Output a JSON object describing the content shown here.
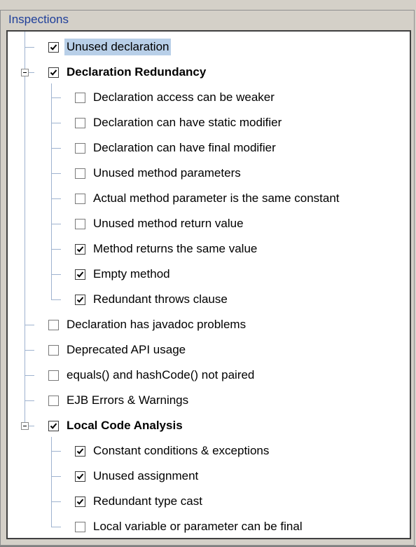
{
  "panel": {
    "title": "Inspections"
  },
  "tree": {
    "items": [
      {
        "label": "Unused declaration",
        "checked": true,
        "level": 0,
        "selected": true,
        "bold": false,
        "expanded": false,
        "last": false
      },
      {
        "label": "Declaration Redundancy",
        "checked": true,
        "level": 0,
        "selected": false,
        "bold": true,
        "expanded": true,
        "last": false
      },
      {
        "label": "Declaration access can be weaker",
        "checked": false,
        "level": 1,
        "selected": false,
        "bold": false,
        "expanded": false,
        "last": false
      },
      {
        "label": "Declaration can have static modifier",
        "checked": false,
        "level": 1,
        "selected": false,
        "bold": false,
        "expanded": false,
        "last": false
      },
      {
        "label": "Declaration can have final modifier",
        "checked": false,
        "level": 1,
        "selected": false,
        "bold": false,
        "expanded": false,
        "last": false
      },
      {
        "label": "Unused method parameters",
        "checked": false,
        "level": 1,
        "selected": false,
        "bold": false,
        "expanded": false,
        "last": false
      },
      {
        "label": "Actual method parameter is the same constant",
        "checked": false,
        "level": 1,
        "selected": false,
        "bold": false,
        "expanded": false,
        "last": false
      },
      {
        "label": "Unused method return value",
        "checked": false,
        "level": 1,
        "selected": false,
        "bold": false,
        "expanded": false,
        "last": false
      },
      {
        "label": "Method returns the same value",
        "checked": true,
        "level": 1,
        "selected": false,
        "bold": false,
        "expanded": false,
        "last": false
      },
      {
        "label": "Empty method",
        "checked": true,
        "level": 1,
        "selected": false,
        "bold": false,
        "expanded": false,
        "last": false
      },
      {
        "label": "Redundant throws clause",
        "checked": true,
        "level": 1,
        "selected": false,
        "bold": false,
        "expanded": false,
        "last": true
      },
      {
        "label": "Declaration has javadoc problems",
        "checked": false,
        "level": 0,
        "selected": false,
        "bold": false,
        "expanded": false,
        "last": false
      },
      {
        "label": "Deprecated API usage",
        "checked": false,
        "level": 0,
        "selected": false,
        "bold": false,
        "expanded": false,
        "last": false
      },
      {
        "label": "equals() and hashCode() not paired",
        "checked": false,
        "level": 0,
        "selected": false,
        "bold": false,
        "expanded": false,
        "last": false
      },
      {
        "label": "EJB Errors & Warnings",
        "checked": false,
        "level": 0,
        "selected": false,
        "bold": false,
        "expanded": false,
        "last": false
      },
      {
        "label": "Local Code Analysis",
        "checked": true,
        "level": 0,
        "selected": false,
        "bold": true,
        "expanded": true,
        "last": true
      },
      {
        "label": "Constant conditions & exceptions",
        "checked": true,
        "level": 1,
        "selected": false,
        "bold": false,
        "expanded": false,
        "last": false
      },
      {
        "label": "Unused assignment",
        "checked": true,
        "level": 1,
        "selected": false,
        "bold": false,
        "expanded": false,
        "last": false
      },
      {
        "label": "Redundant type cast",
        "checked": true,
        "level": 1,
        "selected": false,
        "bold": false,
        "expanded": false,
        "last": false
      },
      {
        "label": "Local variable or parameter can be final",
        "checked": false,
        "level": 1,
        "selected": false,
        "bold": false,
        "expanded": false,
        "last": true
      }
    ]
  }
}
